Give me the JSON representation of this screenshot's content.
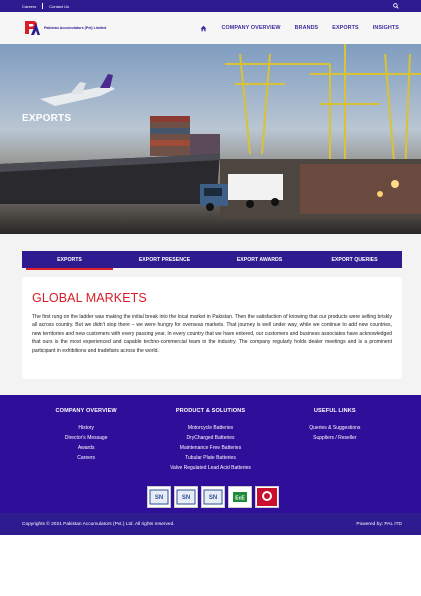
{
  "topbar": {
    "careers": "Careers",
    "contact": "Contact Us"
  },
  "brand": {
    "logo_text": "Pakistan Accumulators (Pvt) Limited"
  },
  "nav": {
    "items": [
      "COMPANY OVERVIEW",
      "BRANDS",
      "EXPORTS",
      "INSIGHTS"
    ]
  },
  "hero": {
    "title": "EXPORTS"
  },
  "tabs": [
    "EXPORTS",
    "EXPORT PRESENCE",
    "EXPORT AWARDS",
    "EXPORT QUERIES"
  ],
  "content": {
    "heading": "GLOBAL MARKETS",
    "body": "The first rung on the ladder was making the initial break into the local market in Pakistan. Then the satisfaction of knowing that our products were selling briskly all across country. But we didn't stop there – we were hungry for overseas markets. That journey is well under way, while we continue to add new countries, new territories and new customers with every passing year. In every country that we have entered, our customers and business associates have acknowledged that ours is the most experienced and capable techno-commercial team in the industry. The company regularly holds dealer meetings and is a prominent participant in exhibitions and tradefairs across the world."
  },
  "footer": {
    "col1": {
      "title": "COMPANY OVERVIEW",
      "links": [
        "History",
        "Director's Message",
        "Awards",
        "Careers"
      ]
    },
    "col2": {
      "title": "PRODUCT & SOLUTIONS",
      "links": [
        "Motorcycle Batteries",
        "DryCharged Batteries",
        "Maintenance Free Batteries",
        "Tubular Plate Batteries",
        "Valve Regulated Lead Acid Batteries"
      ]
    },
    "col3": {
      "title": "USEFUL LINKS",
      "links": [
        "Queries & Suggestions",
        "Suppliers / Reseller"
      ]
    },
    "copyright": "Copyrights © 2021 Pakistan Accumulators (Pvt.) Ltd. All rights reserved.",
    "powered": "Powered by: PAL ITD"
  },
  "colors": {
    "brand_blue": "#2d1b8f",
    "footer_purple": "#2f0e9a",
    "accent_red": "#d71e27"
  }
}
